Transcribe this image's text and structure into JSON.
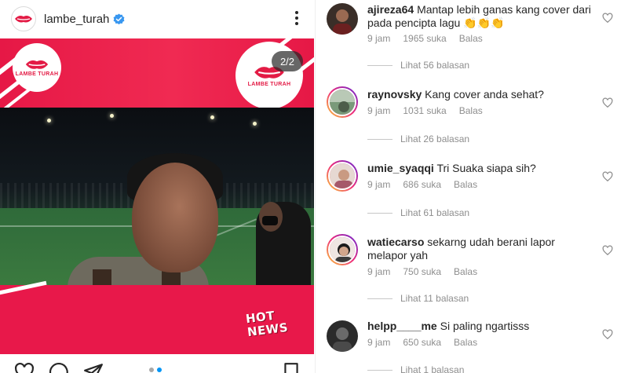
{
  "post": {
    "username": "lambe_turah",
    "brand_name": "LAMBE TURAH",
    "brand_tagline": "",
    "slide_counter": "2/2",
    "hot_line1": "HOT",
    "hot_line2": "NEWS",
    "colors": {
      "brand_red": "#e8184a",
      "verified_blue": "#3897f0",
      "dot_active": "#0095f6",
      "dot_inactive": "#a8a8a8"
    }
  },
  "comments": [
    {
      "user": "ajireza64",
      "text": "Mantap lebih ganas kang cover dari pada pencipta lagu 👏👏👏",
      "time": "9 jam",
      "likes": "1965 suka",
      "reply": "Balas",
      "replies": "Lihat 56 balasan"
    },
    {
      "user": "raynovsky",
      "text": "Kang cover anda sehat?",
      "time": "9 jam",
      "likes": "1031 suka",
      "reply": "Balas",
      "replies": "Lihat 26 balasan"
    },
    {
      "user": "umie_syaqqi",
      "text": "Tri Suaka siapa sih?",
      "time": "9 jam",
      "likes": "686 suka",
      "reply": "Balas",
      "replies": "Lihat 61 balasan"
    },
    {
      "user": "watiecarso",
      "text": "sekarng udah berani lapor melapor yah",
      "time": "9 jam",
      "likes": "750 suka",
      "reply": "Balas",
      "replies": "Lihat 11 balasan"
    },
    {
      "user": "helpp____me",
      "text": "Si paling ngartisss",
      "time": "9 jam",
      "likes": "650 suka",
      "reply": "Balas",
      "replies": "Lihat 1 balasan"
    }
  ],
  "icons": {
    "more": "more-options-icon",
    "verified": "verified-badge-icon",
    "like": "heart-icon",
    "comment": "comment-icon",
    "share": "share-icon",
    "save": "bookmark-icon"
  }
}
